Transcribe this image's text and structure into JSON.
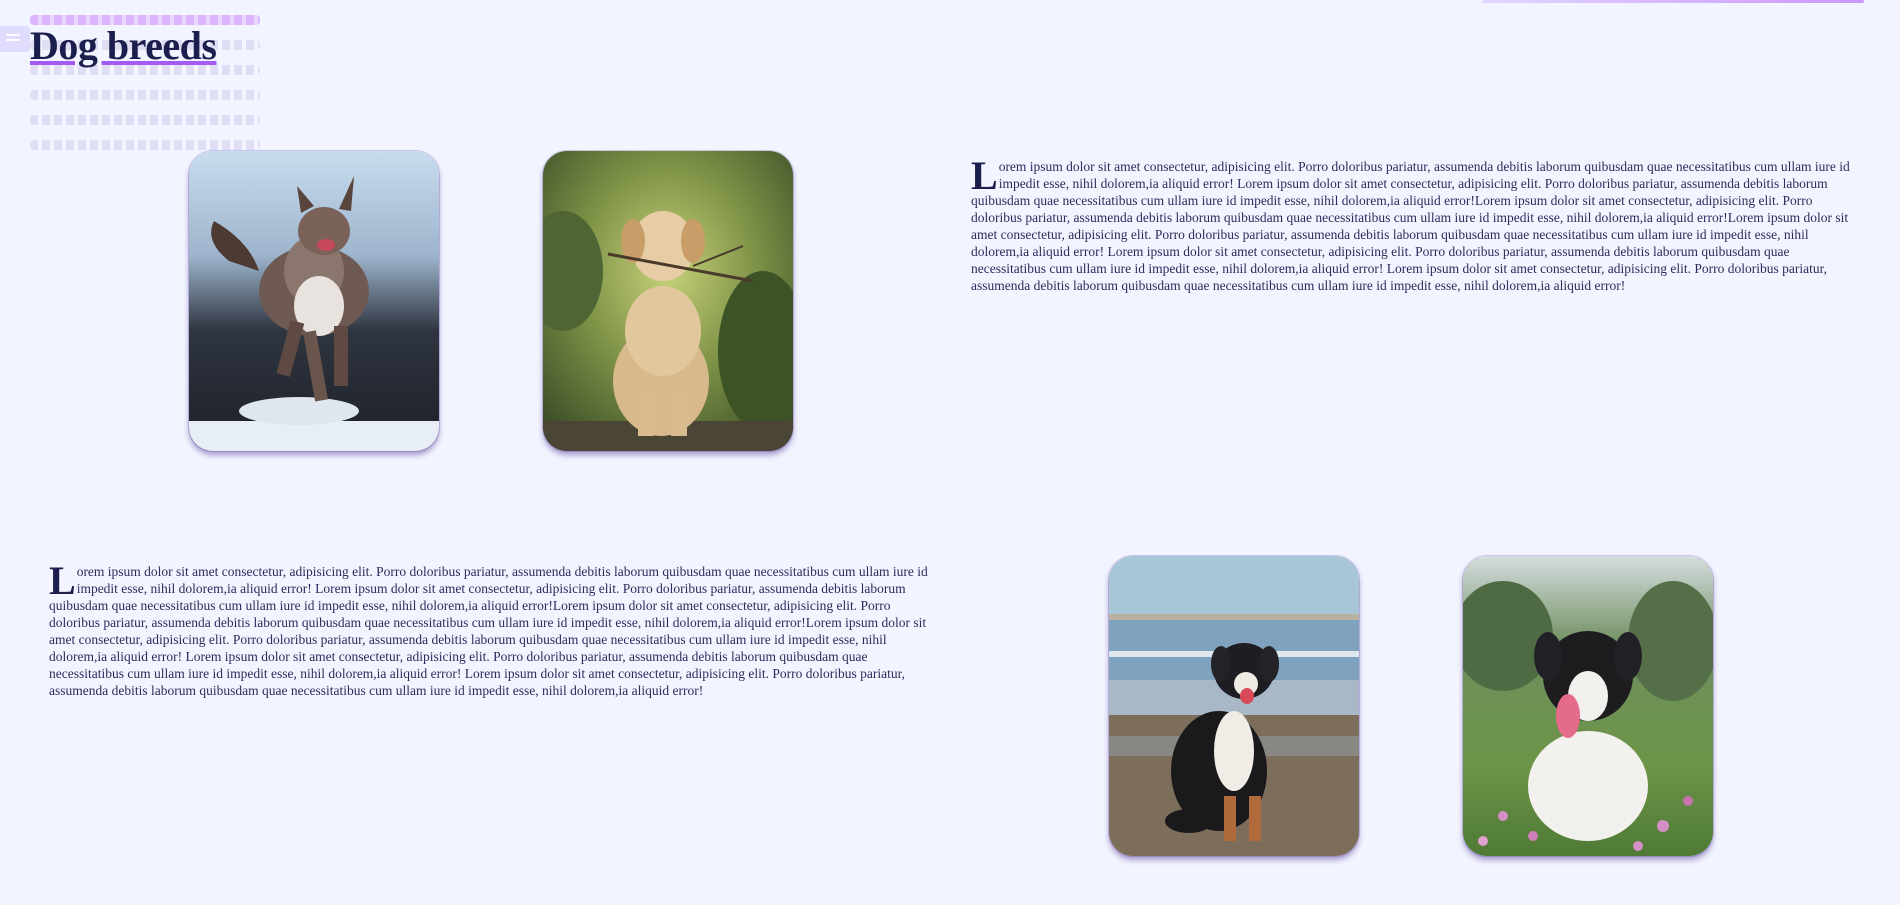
{
  "page": {
    "title": "Dog breeds"
  },
  "sections": [
    {
      "dropcap": "L",
      "text": "orem ipsum dolor sit amet consectetur, adipisicing elit. Porro doloribus pariatur, assumenda debitis laborum quibusdam quae necessitatibus cum ullam iure id impedit esse, nihil dolorem,ia aliquid error! Lorem ipsum dolor sit amet consectetur, adipisicing elit. Porro doloribus pariatur, assumenda debitis laborum quibusdam quae necessitatibus cum ullam iure id impedit esse, nihil dolorem,ia aliquid error!Lorem ipsum dolor sit amet consectetur, adipisicing elit. Porro doloribus pariatur, assumenda debitis laborum quibusdam quae necessitatibus cum ullam iure id impedit esse, nihil dolorem,ia aliquid error!Lorem ipsum dolor sit amet consectetur, adipisicing elit. Porro doloribus pariatur, assumenda debitis laborum quibusdam quae necessitatibus cum ullam iure id impedit esse, nihil dolorem,ia aliquid error! Lorem ipsum dolor sit amet consectetur, adipisicing elit. Porro doloribus pariatur, assumenda debitis laborum quibusdam quae necessitatibus cum ullam iure id impedit esse, nihil dolorem,ia aliquid error! Lorem ipsum dolor sit amet consectetur, adipisicing elit. Porro doloribus pariatur, assumenda debitis laborum quibusdam quae necessitatibus cum ullam iure id impedit esse, nihil dolorem,ia aliquid error!"
    },
    {
      "dropcap": "L",
      "text": "orem ipsum dolor sit amet consectetur, adipisicing elit. Porro doloribus pariatur, assumenda debitis laborum quibusdam quae necessitatibus cum ullam iure id impedit esse, nihil dolorem,ia aliquid error! Lorem ipsum dolor sit amet consectetur, adipisicing elit. Porro doloribus pariatur, assumenda debitis laborum quibusdam quae necessitatibus cum ullam iure id impedit esse, nihil dolorem,ia aliquid error!Lorem ipsum dolor sit amet consectetur, adipisicing elit. Porro doloribus pariatur, assumenda debitis laborum quibusdam quae necessitatibus cum ullam iure id impedit esse, nihil dolorem,ia aliquid error!Lorem ipsum dolor sit amet consectetur, adipisicing elit. Porro doloribus pariatur, assumenda debitis laborum quibusdam quae necessitatibus cum ullam iure id impedit esse, nihil dolorem,ia aliquid error! Lorem ipsum dolor sit amet consectetur, adipisicing elit. Porro doloribus pariatur, assumenda debitis laborum quibusdam quae necessitatibus cum ullam iure id impedit esse, nihil dolorem,ia aliquid error! Lorem ipsum dolor sit amet consectetur, adipisicing elit. Porro doloribus pariatur, assumenda debitis laborum quibusdam quae necessitatibus cum ullam iure id impedit esse, nihil dolorem,ia aliquid error!"
    }
  ],
  "colors": {
    "background": "#f2f4ff",
    "title": "#1c1f4d",
    "accent": "#a45bf5",
    "text": "#2a2d5c"
  }
}
